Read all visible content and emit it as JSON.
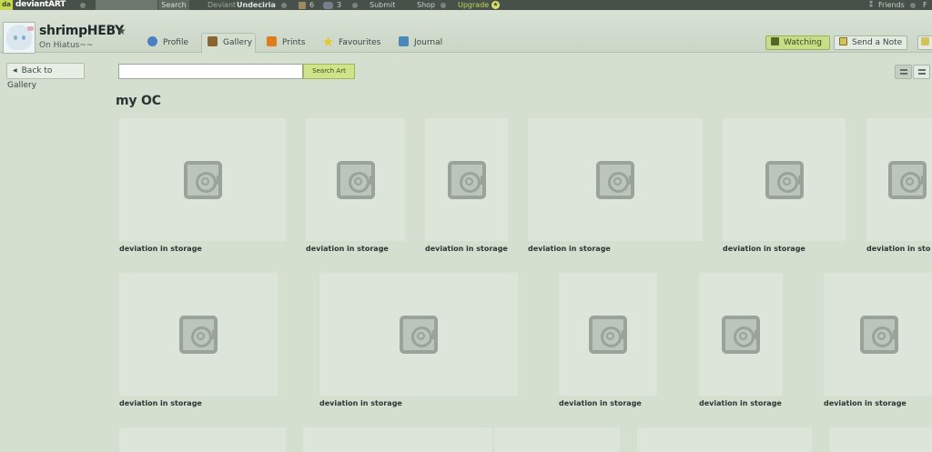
{
  "topbar": {
    "logo": "deviantART",
    "search_button": "Search",
    "deviant_label": "Deviant",
    "deviant_name": "Undeciria",
    "notif_count_1": "6",
    "notif_count_2": "3",
    "submit": "Submit",
    "shop": "Shop",
    "upgrade": "Upgrade",
    "friends": "Friends",
    "extra": "F"
  },
  "profile": {
    "username": "shrimpHEBY",
    "status": "On Hiatus~~"
  },
  "tabs": [
    {
      "label": "Profile"
    },
    {
      "label": "Gallery"
    },
    {
      "label": "Prints"
    },
    {
      "label": "Favourites"
    },
    {
      "label": "Journal"
    }
  ],
  "actions": {
    "watching": "Watching",
    "send_note": "Send a Note"
  },
  "controls": {
    "back": "Back to Gallery",
    "search_value": "",
    "search_button": "Search Art"
  },
  "gallery": {
    "title": "my OC",
    "item_caption": "deviation in storage",
    "captions": [
      "deviation in storage",
      "deviation in storage",
      "deviation in storage",
      "deviation in storage",
      "deviation in storage",
      "deviation in sto",
      "deviation in storage",
      "deviation in storage",
      "deviation in storage",
      "deviation in storage",
      "deviation in storage"
    ]
  },
  "colors": {
    "background": "#d4dfd0",
    "topbar": "#475149",
    "accent_green": "#c7dd88",
    "thumb": "#dde5da"
  },
  "icons": [
    "search-icon",
    "star-icon",
    "profile-icon",
    "gallery-icon",
    "prints-icon",
    "favourites-icon",
    "journal-icon",
    "watching-icon",
    "note-icon",
    "safe-icon",
    "list-view-icon",
    "grid-view-icon"
  ]
}
